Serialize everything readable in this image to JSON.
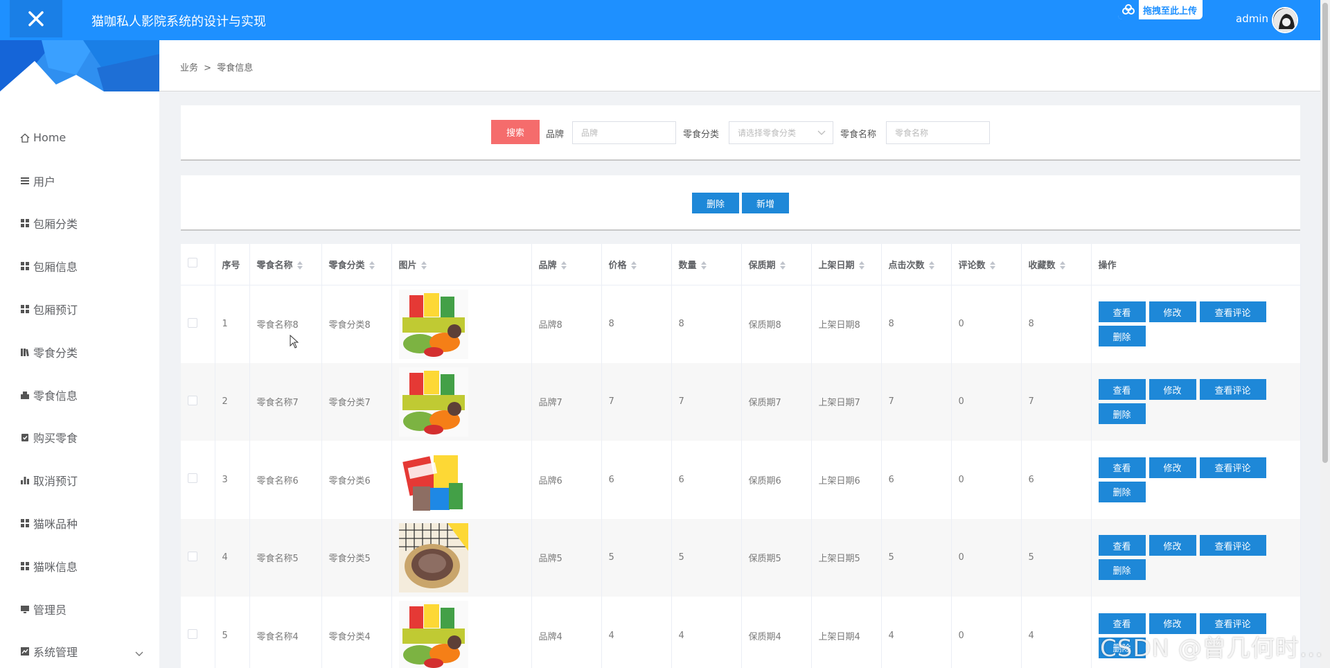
{
  "header": {
    "title": "猫咖私人影院系统的设计与实现",
    "upload_text": "拖拽至此上传",
    "username": "admin",
    "brand_color": "#1e90ff"
  },
  "sidebar": {
    "items": [
      {
        "label": "Home",
        "icon": "home-icon"
      },
      {
        "label": "用户",
        "icon": "list-icon"
      },
      {
        "label": "包厢分类",
        "icon": "grid-icon"
      },
      {
        "label": "包厢信息",
        "icon": "grid-icon"
      },
      {
        "label": "包厢预订",
        "icon": "grid-icon"
      },
      {
        "label": "零食分类",
        "icon": "book-icon"
      },
      {
        "label": "零食信息",
        "icon": "cart-icon"
      },
      {
        "label": "购买零食",
        "icon": "clipboard-icon"
      },
      {
        "label": "取消预订",
        "icon": "bar-chart-icon"
      },
      {
        "label": "猫咪品种",
        "icon": "grid-icon"
      },
      {
        "label": "猫咪信息",
        "icon": "grid-icon"
      },
      {
        "label": "管理员",
        "icon": "monitor-icon"
      },
      {
        "label": "系统管理",
        "icon": "chart-icon"
      }
    ]
  },
  "breadcrumb": {
    "parent": "业务",
    "separator": ">",
    "current": "零食信息"
  },
  "search": {
    "button": "搜索",
    "brand_label": "品牌",
    "brand_placeholder": "品牌",
    "category_label": "零食分类",
    "category_placeholder": "请选择零食分类",
    "name_label": "零食名称",
    "name_placeholder": "零食名称"
  },
  "actions": {
    "delete": "删除",
    "add": "新增"
  },
  "table": {
    "columns": [
      "序号",
      "零食名称",
      "零食分类",
      "图片",
      "品牌",
      "价格",
      "数量",
      "保质期",
      "上架日期",
      "点击次数",
      "评论数",
      "收藏数",
      "操作"
    ],
    "row_actions": {
      "view": "查看",
      "edit": "修改",
      "comments": "查看评论",
      "delete": "删除"
    },
    "rows": [
      {
        "index": "1",
        "name": "零食名称8",
        "category": "零食分类8",
        "image": "snack-mix",
        "brand": "品牌8",
        "price": "8",
        "qty": "8",
        "shelf": "保质期8",
        "date": "上架日期8",
        "clicks": "8",
        "comments": "0",
        "favorites": "8"
      },
      {
        "index": "2",
        "name": "零食名称7",
        "category": "零食分类7",
        "image": "snack-mix",
        "brand": "品牌7",
        "price": "7",
        "qty": "7",
        "shelf": "保质期7",
        "date": "上架日期7",
        "clicks": "7",
        "comments": "0",
        "favorites": "7"
      },
      {
        "index": "3",
        "name": "零食名称6",
        "category": "零食分类6",
        "image": "imported-snacks",
        "brand": "品牌6",
        "price": "6",
        "qty": "6",
        "shelf": "保质期6",
        "date": "上架日期6",
        "clicks": "6",
        "comments": "0",
        "favorites": "6"
      },
      {
        "index": "4",
        "name": "零食名称5",
        "category": "零食分类5",
        "image": "cookie-plate",
        "brand": "品牌5",
        "price": "5",
        "qty": "5",
        "shelf": "保质期5",
        "date": "上架日期5",
        "clicks": "5",
        "comments": "0",
        "favorites": "5"
      },
      {
        "index": "5",
        "name": "零食名称4",
        "category": "零食分类4",
        "image": "snack-mix",
        "brand": "品牌4",
        "price": "4",
        "qty": "4",
        "shelf": "保质期4",
        "date": "上架日期4",
        "clicks": "4",
        "comments": "0",
        "favorites": "4"
      }
    ]
  },
  "watermark": "CSDN @曾几何时…",
  "colors": {
    "primary_button": "#1e88d8",
    "search_button": "#f56c6c"
  }
}
